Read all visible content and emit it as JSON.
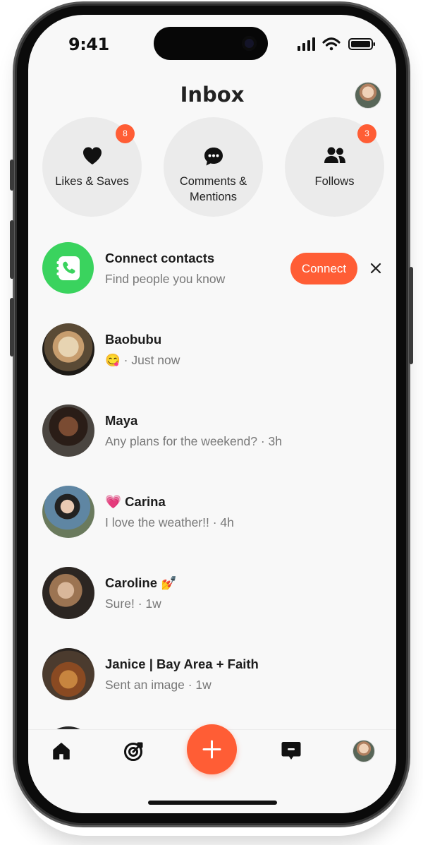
{
  "status_bar": {
    "time": "9:41"
  },
  "header": {
    "title": "Inbox"
  },
  "categories": [
    {
      "label": "Likes & Saves",
      "badge": "8",
      "icon": "heart-icon"
    },
    {
      "label": "Comments &\nMentions",
      "badge": "",
      "icon": "chat-bubble-icon"
    },
    {
      "label": "Follows",
      "badge": "3",
      "icon": "people-icon"
    }
  ],
  "connect": {
    "title": "Connect contacts",
    "subtitle": "Find people you know",
    "button_label": "Connect",
    "icon": "contacts-book-icon"
  },
  "messages": [
    {
      "name": "Baobubu",
      "preview": "😋 · Just now"
    },
    {
      "name": "Maya",
      "preview": "Any plans for the weekend? · 3h"
    },
    {
      "name": "💗 Carina",
      "preview": "I love the weather!! · 4h"
    },
    {
      "name": "Caroline 💅",
      "preview": "Sure! · 1w"
    },
    {
      "name": "Janice | Bay Area + Faith",
      "preview": "Sent an image · 1w"
    }
  ],
  "tab_bar": {
    "items": [
      "home-icon",
      "target-icon",
      "add-icon",
      "message-icon",
      "profile-avatar"
    ]
  },
  "colors": {
    "accent": "#ff5d35",
    "contacts_green": "#3ad35e",
    "screen_bg": "#f8f8f8",
    "card_bg": "#ebebeb"
  }
}
